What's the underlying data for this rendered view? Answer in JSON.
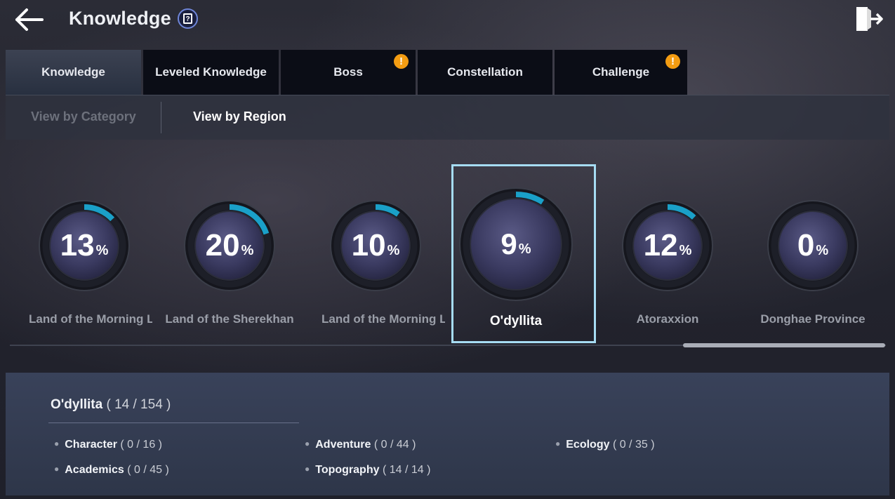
{
  "header": {
    "title": "Knowledge"
  },
  "tabs": [
    {
      "label": "Knowledge",
      "active": true,
      "alert": false
    },
    {
      "label": "Leveled Knowledge",
      "active": false,
      "alert": false
    },
    {
      "label": "Boss",
      "active": false,
      "alert": true
    },
    {
      "label": "Constellation",
      "active": false,
      "alert": false
    },
    {
      "label": "Challenge",
      "active": false,
      "alert": true
    }
  ],
  "badge_glyph": "!",
  "subtabs": [
    {
      "label": "View by Category",
      "active": false
    },
    {
      "label": "View by Region",
      "active": true
    }
  ],
  "percent_sign": "%",
  "regions": [
    {
      "name": "Land of the Morning Light",
      "percent": 13,
      "selected": false
    },
    {
      "name": "Land of the Sherekhan",
      "percent": 20,
      "selected": false
    },
    {
      "name": "Land of the Morning Light",
      "percent": 10,
      "selected": false
    },
    {
      "name": "O'dyllita",
      "percent": 9,
      "selected": true
    },
    {
      "name": "Atoraxxion",
      "percent": 12,
      "selected": false
    },
    {
      "name": "Donghae Province",
      "percent": 0,
      "selected": false
    }
  ],
  "detail": {
    "region": "O'dyllita",
    "count": "( 14 / 154 )",
    "categories": [
      {
        "label": "Character",
        "count": "( 0 / 16 )"
      },
      {
        "label": "Adventure",
        "count": "( 0 / 44 )"
      },
      {
        "label": "Ecology",
        "count": "( 0 / 35 )"
      },
      {
        "label": "Academics",
        "count": "( 0 / 45 )"
      },
      {
        "label": "Topography",
        "count": "( 14 / 14 )"
      }
    ]
  },
  "colors": {
    "accent": "#1aa0c8",
    "selection": "#a6dcf3",
    "alert": "#f39c12",
    "help_border": "#6f86d8"
  },
  "icons": {
    "back": "back-arrow-icon",
    "help": "help-book-icon",
    "exit": "exit-door-icon",
    "bullet": "bullet-dot-icon"
  }
}
